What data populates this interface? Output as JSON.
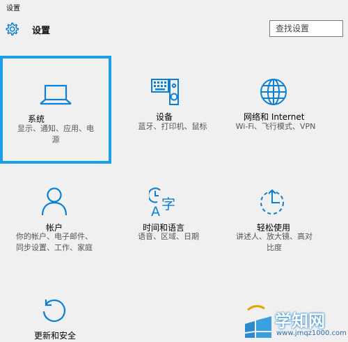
{
  "window": {
    "title": "设置"
  },
  "header": {
    "title": "设置",
    "icon": "gear-icon"
  },
  "search": {
    "placeholder": "查找设置"
  },
  "colors": {
    "accent": "#0a7fd4",
    "selection_border": "#1a9ee8",
    "background": "#f0f0f0"
  },
  "tiles": [
    {
      "id": "system",
      "icon": "laptop-icon",
      "name": "系统",
      "desc1": "显示、通知、应用、电",
      "desc2": "源",
      "selected": true
    },
    {
      "id": "devices",
      "icon": "keyboard-speaker-icon",
      "name": "设备",
      "desc1": "蓝牙、打印机、鼠标",
      "desc2": ""
    },
    {
      "id": "network",
      "icon": "globe-icon",
      "name": "网络和 Internet",
      "desc1": "Wi-Fi、飞行模式、VPN",
      "desc2": ""
    },
    {
      "id": "accounts",
      "icon": "person-icon",
      "name": "帐户",
      "desc1": "你的帐户、电子邮件、",
      "desc2": "同步设置、工作、家庭"
    },
    {
      "id": "time-language",
      "icon": "time-language-icon",
      "name": "时间和语言",
      "desc1": "语音、区域、日期",
      "desc2": ""
    },
    {
      "id": "ease-of-access",
      "icon": "ease-of-access-icon",
      "name": "轻松使用",
      "desc1": "讲述人、放大镜、高对",
      "desc2": "比度"
    },
    {
      "id": "update-security",
      "icon": "refresh-icon",
      "name": "更新和安全",
      "desc1": "",
      "desc2": ""
    }
  ],
  "watermark": {
    "logo_text": "学知网",
    "url": "www.jmqz1000.com"
  }
}
